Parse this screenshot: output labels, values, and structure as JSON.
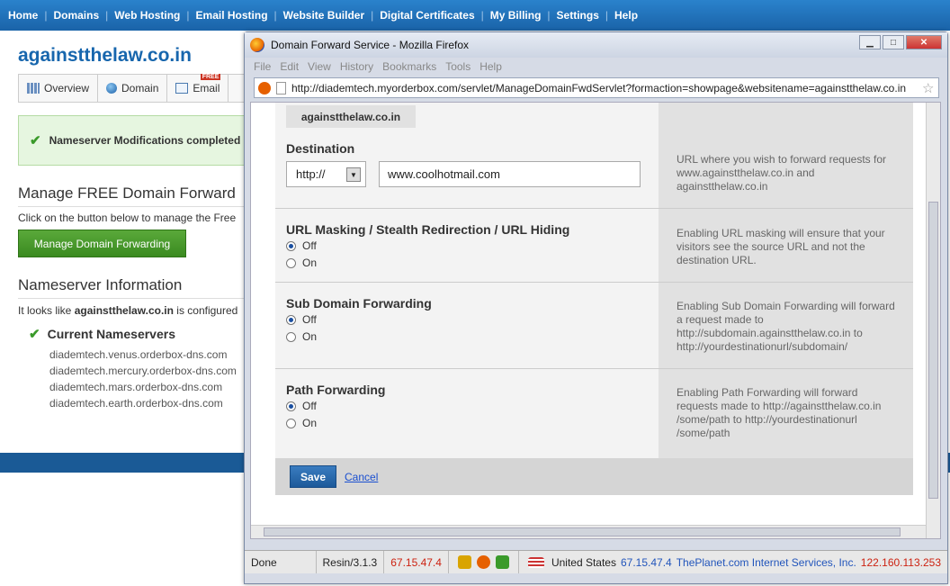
{
  "topnav": [
    "Home",
    "Domains",
    "Web Hosting",
    "Email Hosting",
    "Website Builder",
    "Digital Certificates",
    "My Billing",
    "Settings",
    "Help"
  ],
  "background": {
    "site_title": "againstthelaw.co.in",
    "tabs": [
      {
        "label": "Overview",
        "icon": "grid-icon"
      },
      {
        "label": "Domain",
        "icon": "globe-icon"
      },
      {
        "label": "Email",
        "icon": "mail-icon",
        "badge": "FREE"
      }
    ],
    "success_message": "Nameserver Modifications completed",
    "manage_heading": "Manage FREE Domain Forward",
    "manage_text": "Click on the button below to manage the Free",
    "manage_button": "Manage Domain Forwarding",
    "ns_heading": "Nameserver Information",
    "ns_text_pre": "It looks like ",
    "ns_text_domain": "againstthelaw.co.in",
    "ns_text_post": " is configured",
    "current_ns_label": "Current Nameservers",
    "nameservers": [
      "diademtech.venus.orderbox-dns.com",
      "diademtech.mercury.orderbox-dns.com",
      "diademtech.mars.orderbox-dns.com",
      "diademtech.earth.orderbox-dns.com"
    ]
  },
  "window": {
    "title": "Domain Forward Service - Mozilla Firefox",
    "menu": [
      "File",
      "Edit",
      "View",
      "History",
      "Bookmarks",
      "Tools",
      "Help"
    ],
    "url": "http://diademtech.myorderbox.com/servlet/ManageDomainFwdServlet?formaction=showpage&websitename=againstthelaw.co.in"
  },
  "form": {
    "domain": "againstthelaw.co.in",
    "destination_label": "Destination",
    "protocol": "http://",
    "destination_value": "www.coolhotmail.com",
    "destination_help": "URL where you wish to forward requests for www.againstthelaw.co.in and againstthelaw.co.in",
    "masking_label": "URL Masking / Stealth Redirection / URL Hiding",
    "masking_help": "Enabling URL masking will ensure that your visitors see the source URL and not the destination URL.",
    "subdomain_label": "Sub Domain Forwarding",
    "subdomain_help": "Enabling Sub Domain Forwarding will forward a request made to http://subdomain.againstthelaw.co.in to http://yourdestinationurl/subdomain/",
    "path_label": "Path Forwarding",
    "path_help": "Enabling Path Forwarding will forward requests made to http://againstthelaw.co.in /some/path to http://yourdestinationurl /some/path",
    "off_label": "Off",
    "on_label": "On",
    "save": "Save",
    "cancel": "Cancel"
  },
  "status": {
    "done": "Done",
    "server": "Resin/3.1.3",
    "ip1": "67.15.47.4",
    "country": "United States",
    "ip2": "67.15.47.4",
    "isp": "ThePlanet.com Internet Services, Inc.",
    "ip3": "122.160.113.253"
  }
}
